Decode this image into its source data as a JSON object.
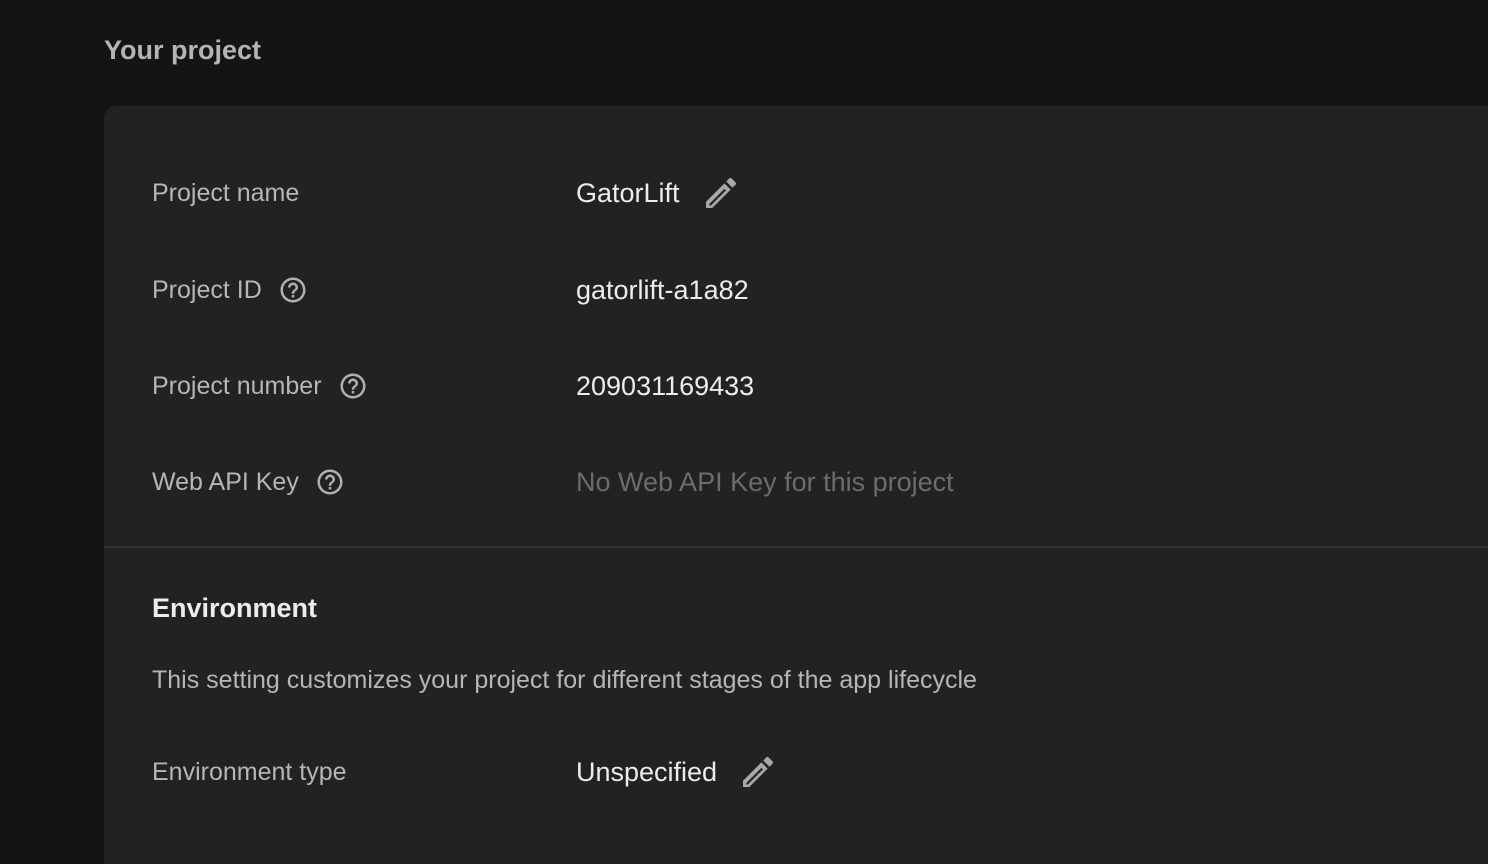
{
  "header": {
    "title": "Your project"
  },
  "project": {
    "rows": [
      {
        "label": "Project name",
        "value": "GatorLift",
        "has_help": false,
        "editable": true
      },
      {
        "label": "Project ID",
        "value": "gatorlift-a1a82",
        "has_help": true,
        "editable": false
      },
      {
        "label": "Project number",
        "value": "209031169433",
        "has_help": true,
        "editable": false
      },
      {
        "label": "Web API Key",
        "value": "No Web API Key for this project",
        "has_help": true,
        "editable": false
      }
    ]
  },
  "environment": {
    "title": "Environment",
    "description": "This setting customizes your project for different stages of the app lifecycle",
    "type_label": "Environment type",
    "type_value": "Unspecified"
  },
  "icons": {
    "help": "help-circle-icon",
    "edit": "pencil-icon"
  },
  "colors": {
    "page_background": "#141414",
    "card_background": "#222222",
    "label_text": "#b6b6b6",
    "value_text": "#ececec",
    "muted_text": "#6c6c6c",
    "icon": "#a8a8a8"
  }
}
